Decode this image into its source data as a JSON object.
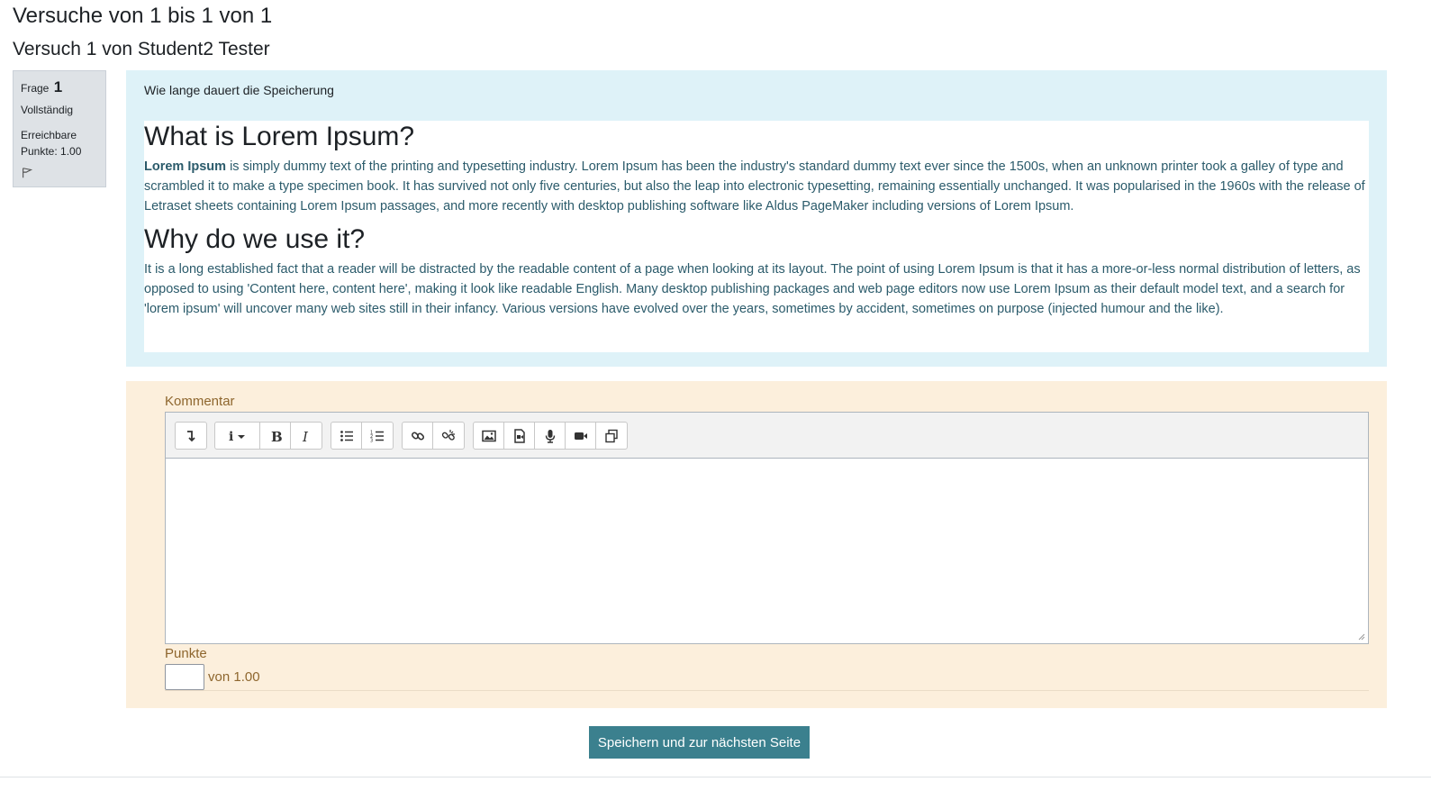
{
  "header": {
    "attempts_title": "Versuche von 1 bis 1 von 1",
    "attempt_title": "Versuch 1 von Student2 Tester"
  },
  "question_info": {
    "label": "Frage",
    "number": "1",
    "state": "Vollständig",
    "grade_line1": "Erreichbare",
    "grade_line2": "Punkte: 1.00",
    "flag_icon": "flag-icon"
  },
  "question": {
    "text": "Wie lange dauert die Speicherung",
    "heading1": "What is Lorem Ipsum?",
    "para1_bold": "Lorem Ipsum",
    "para1_rest": " is simply dummy text of the printing and typesetting industry. Lorem Ipsum has been the industry's standard dummy text ever since the 1500s, when an unknown printer took a galley of type and scrambled it to make a type specimen book. It has survived not only five centuries, but also the leap into electronic typesetting, remaining essentially unchanged. It was popularised in the 1960s with the release of Letraset sheets containing Lorem Ipsum passages, and more recently with desktop publishing software like Aldus PageMaker including versions of Lorem Ipsum.",
    "heading2": "Why do we use it?",
    "para2": "It is a long established fact that a reader will be distracted by the readable content of a page when looking at its layout. The point of using Lorem Ipsum is that it has a more-or-less normal distribution of letters, as opposed to using 'Content here, content here', making it look like readable English. Many desktop publishing packages and web page editors now use Lorem Ipsum as their default model text, and a search for 'lorem ipsum' will uncover many web sites still in their infancy. Various versions have evolved over the years, sometimes by accident, sometimes on purpose (injected humour and the like)."
  },
  "comment": {
    "label": "Kommentar",
    "value": "",
    "toolbar_icons": [
      "collapse-icon",
      "info-icon",
      "bold-icon",
      "italic-icon",
      "bullet-list-icon",
      "numbered-list-icon",
      "link-icon",
      "unlink-icon",
      "image-icon",
      "media-icon",
      "microphone-icon",
      "video-icon",
      "manage-files-icon"
    ]
  },
  "points": {
    "label": "Punkte",
    "value": "",
    "of_text": "von 1.00"
  },
  "submit_label": "Speichern und zur nächsten Seite",
  "colors": {
    "accent": "#3b808e",
    "formulation_bg": "#def2f8",
    "comment_bg": "#fcefdc"
  }
}
